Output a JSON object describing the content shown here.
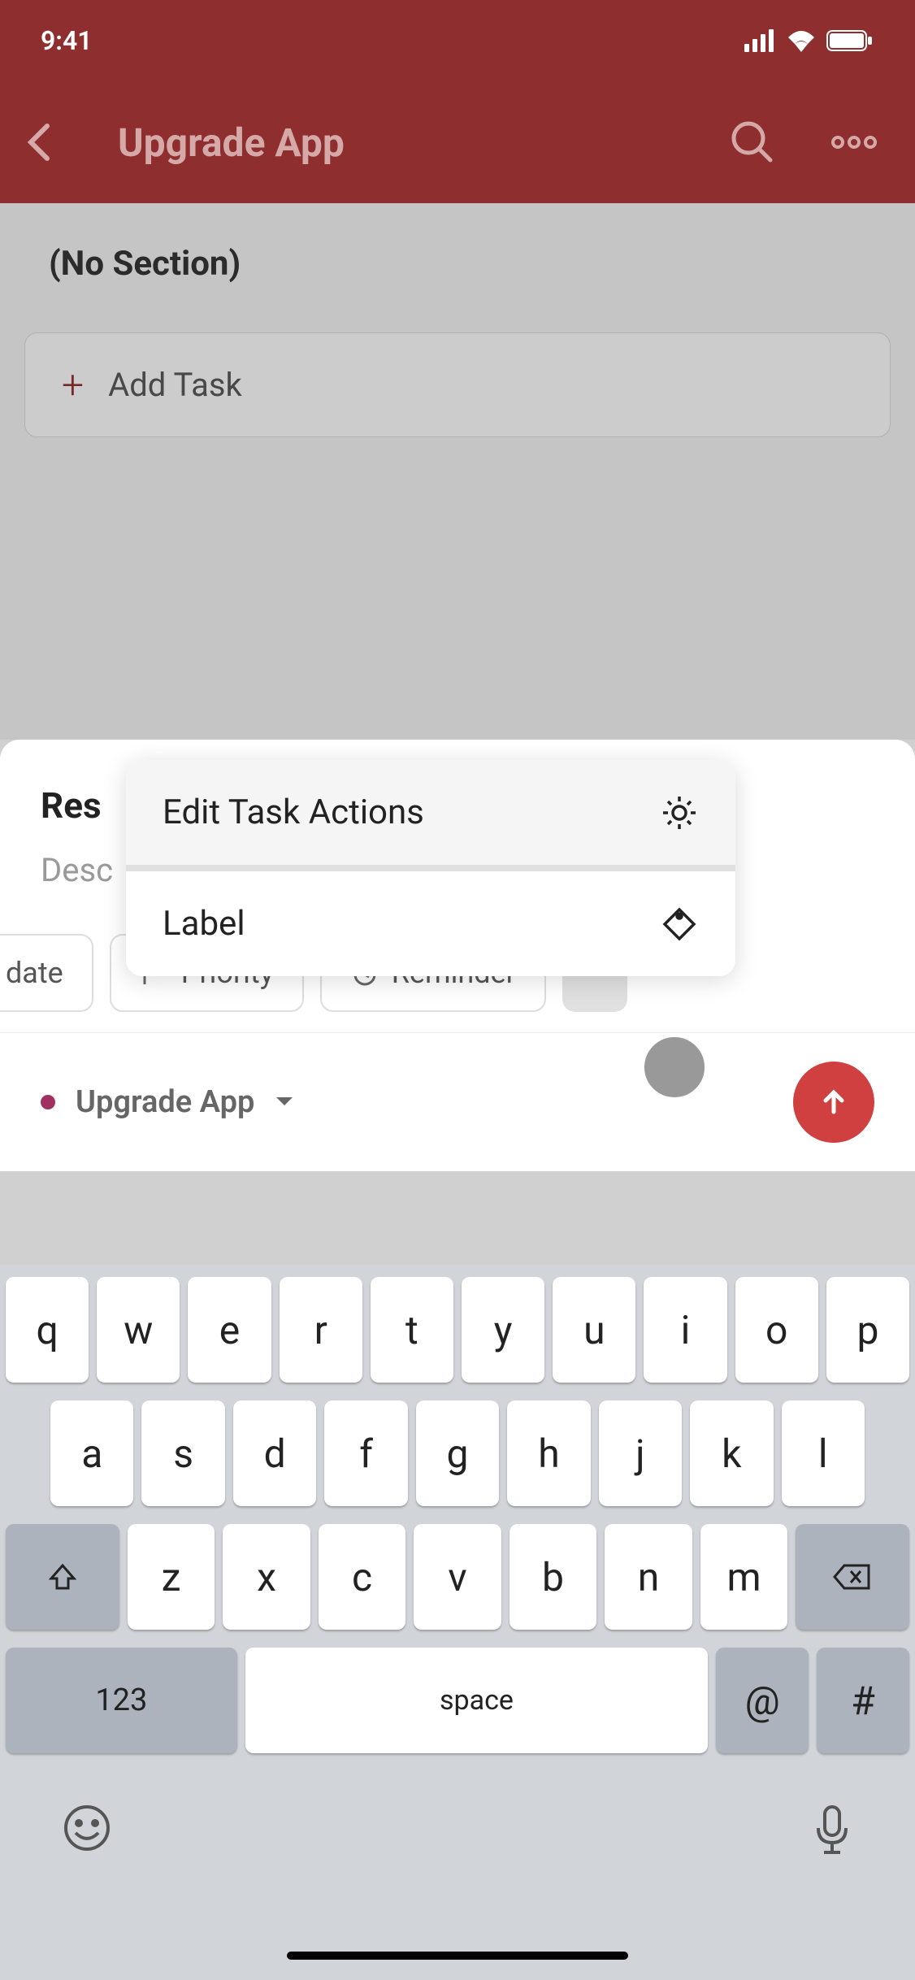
{
  "status": {
    "time": "9:41"
  },
  "header": {
    "title": "Upgrade App"
  },
  "content": {
    "section_title": "(No Section)",
    "add_task_label": "Add Task"
  },
  "task_sheet": {
    "task_title": "Res",
    "description_placeholder": "Desc"
  },
  "popup": {
    "edit_actions": "Edit Task Actions",
    "label": "Label"
  },
  "chips": {
    "date": "date",
    "priority": "Priority",
    "reminder": "Reminder"
  },
  "project": {
    "name": "Upgrade App"
  },
  "keyboard": {
    "row1": [
      "q",
      "w",
      "e",
      "r",
      "t",
      "y",
      "u",
      "i",
      "o",
      "p"
    ],
    "row2": [
      "a",
      "s",
      "d",
      "f",
      "g",
      "h",
      "j",
      "k",
      "l"
    ],
    "row3": [
      "z",
      "x",
      "c",
      "v",
      "b",
      "n",
      "m"
    ],
    "num_key": "123",
    "space_key": "space",
    "at_key": "@",
    "hash_key": "#"
  }
}
